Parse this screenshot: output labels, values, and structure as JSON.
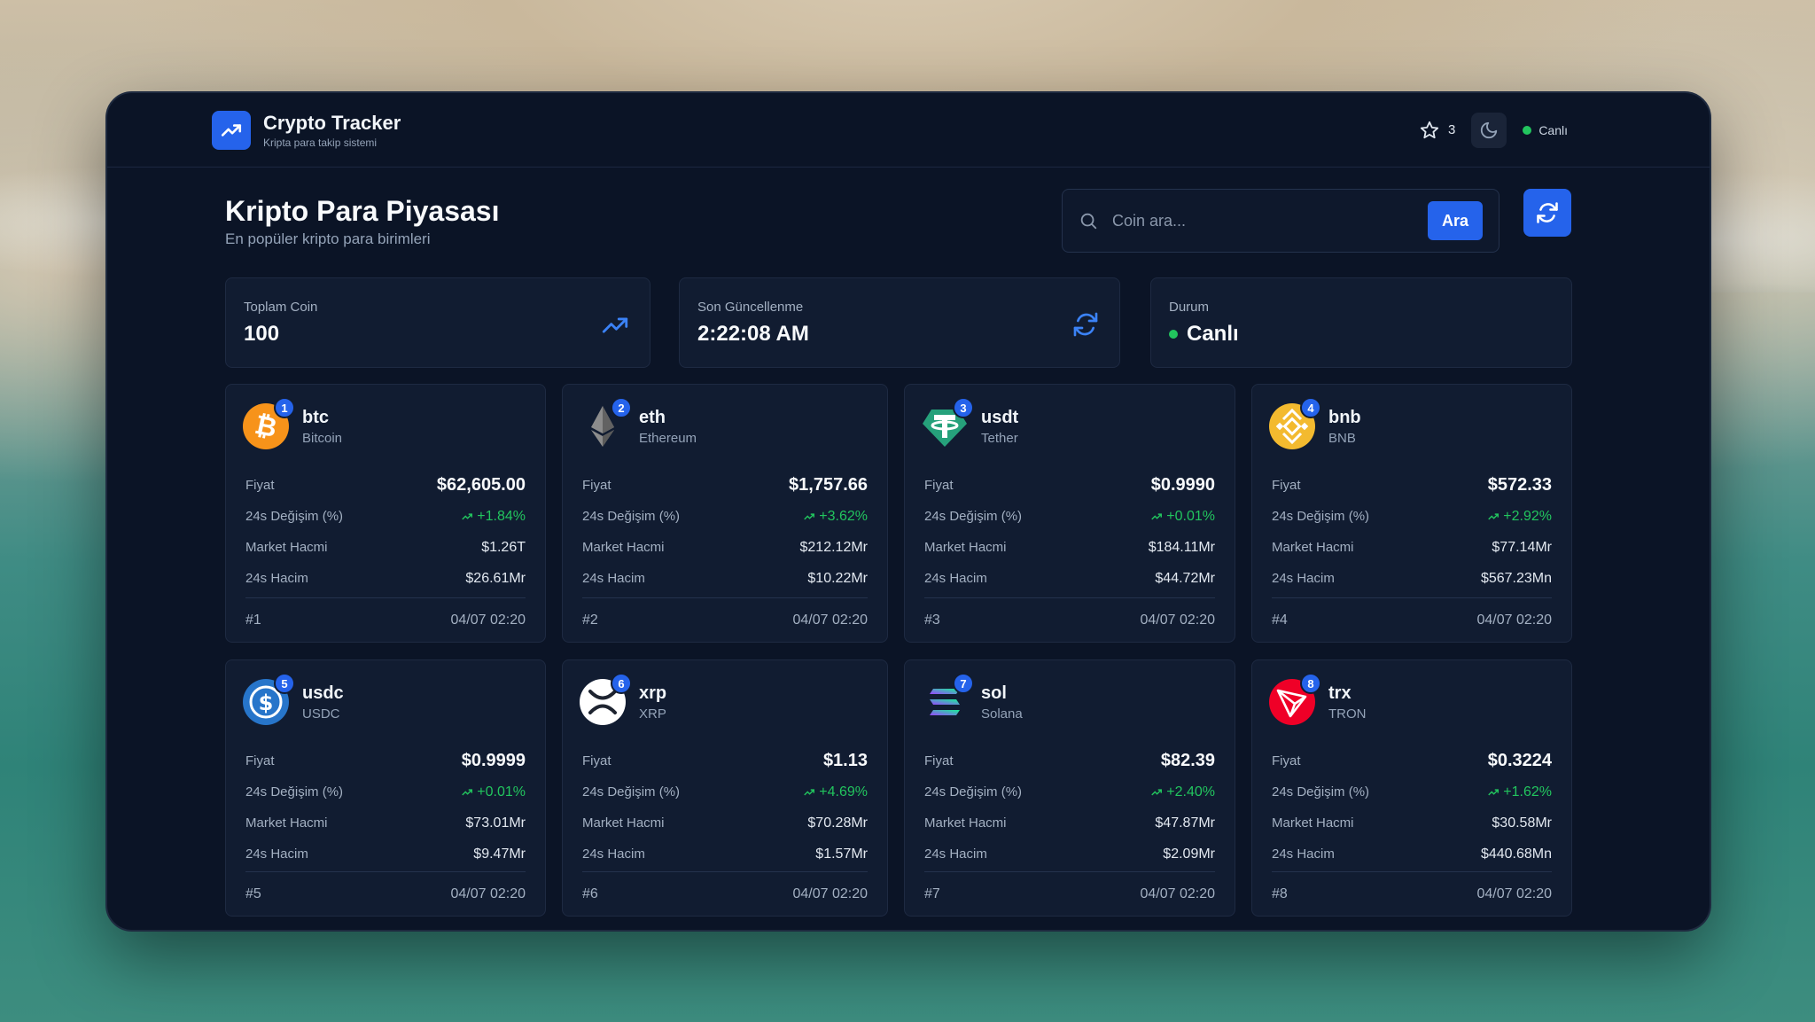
{
  "app": {
    "title": "Crypto Tracker",
    "subtitle": "Kripta para takip sistemi",
    "favorites_count": "3",
    "live_label": "Canlı"
  },
  "header": {
    "title": "Kripto Para Piyasası",
    "subtitle": "En popüler kripto para birimleri"
  },
  "search": {
    "placeholder": "Coin ara...",
    "button_label": "Ara"
  },
  "stats": {
    "total": {
      "label": "Toplam Coin",
      "value": "100"
    },
    "updated": {
      "label": "Son Güncellenme",
      "value": "2:22:08 AM"
    },
    "status": {
      "label": "Durum",
      "value": "Canlı"
    }
  },
  "labels": {
    "price": "Fiyat",
    "change": "24s Değişim (%)",
    "market_cap": "Market Hacmi",
    "volume": "24s Hacim"
  },
  "coins": [
    {
      "rank": "1",
      "symbol": "btc",
      "name": "Bitcoin",
      "price": "$62,605.00",
      "change": "+1.84%",
      "market_cap": "$1.26T",
      "volume": "$26.61Mr",
      "rank_label": "#1",
      "updated": "04/07 02:20",
      "icon": "bitcoin-icon",
      "color": "#f7931a"
    },
    {
      "rank": "2",
      "symbol": "eth",
      "name": "Ethereum",
      "price": "$1,757.66",
      "change": "+3.62%",
      "market_cap": "$212.12Mr",
      "volume": "$10.22Mr",
      "rank_label": "#2",
      "updated": "04/07 02:20",
      "icon": "ethereum-icon",
      "color": "#8a92b2"
    },
    {
      "rank": "3",
      "symbol": "usdt",
      "name": "Tether",
      "price": "$0.9990",
      "change": "+0.01%",
      "market_cap": "$184.11Mr",
      "volume": "$44.72Mr",
      "rank_label": "#3",
      "updated": "04/07 02:20",
      "icon": "tether-icon",
      "color": "#26a17b"
    },
    {
      "rank": "4",
      "symbol": "bnb",
      "name": "BNB",
      "price": "$572.33",
      "change": "+2.92%",
      "market_cap": "$77.14Mr",
      "volume": "$567.23Mn",
      "rank_label": "#4",
      "updated": "04/07 02:20",
      "icon": "bnb-icon",
      "color": "#f3ba2f"
    },
    {
      "rank": "5",
      "symbol": "usdc",
      "name": "USDC",
      "price": "$0.9999",
      "change": "+0.01%",
      "market_cap": "$73.01Mr",
      "volume": "$9.47Mr",
      "rank_label": "#5",
      "updated": "04/07 02:20",
      "icon": "usdc-icon",
      "color": "#2775ca"
    },
    {
      "rank": "6",
      "symbol": "xrp",
      "name": "XRP",
      "price": "$1.13",
      "change": "+4.69%",
      "market_cap": "$70.28Mr",
      "volume": "$1.57Mr",
      "rank_label": "#6",
      "updated": "04/07 02:20",
      "icon": "xrp-icon",
      "color": "#ffffff"
    },
    {
      "rank": "7",
      "symbol": "sol",
      "name": "Solana",
      "price": "$82.39",
      "change": "+2.40%",
      "market_cap": "$47.87Mr",
      "volume": "$2.09Mr",
      "rank_label": "#7",
      "updated": "04/07 02:20",
      "icon": "solana-icon",
      "color": "#14f195"
    },
    {
      "rank": "8",
      "symbol": "trx",
      "name": "TRON",
      "price": "$0.3224",
      "change": "+1.62%",
      "market_cap": "$30.58Mr",
      "volume": "$440.68Mn",
      "rank_label": "#8",
      "updated": "04/07 02:20",
      "icon": "tron-icon",
      "color": "#ef0027"
    }
  ]
}
